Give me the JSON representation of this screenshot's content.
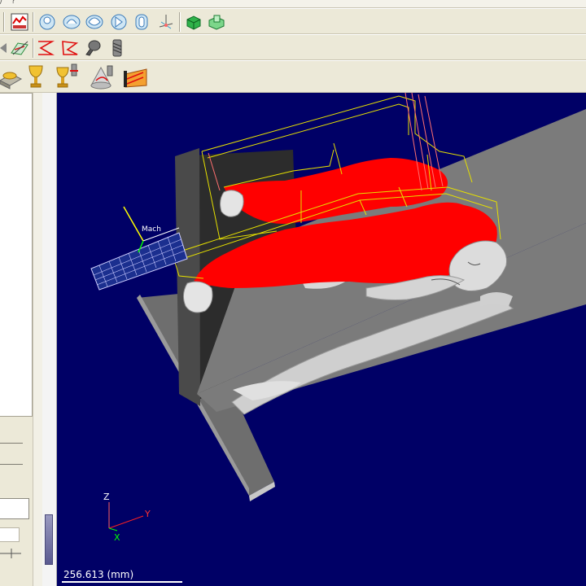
{
  "menubar": {
    "items": [
      "/",
      "?"
    ]
  },
  "toolbar1": {
    "icons": [
      "report-icon",
      "view-front-icon",
      "view-left-icon",
      "view-top-icon",
      "view-right-icon",
      "view-back-icon",
      "view-axis-icon",
      "stock-icon",
      "part-icon"
    ]
  },
  "toolbar2": {
    "icons": [
      "toolpath-edit-icon",
      "zigzag-icon",
      "polyline-icon",
      "tool-icon",
      "drill-icon"
    ]
  },
  "toolbar3": {
    "icons": [
      "surface-icon",
      "trophy-icon",
      "trophy-tool-icon",
      "cone-icon",
      "region-icon"
    ]
  },
  "viewport": {
    "background": "#000066",
    "scale_value": "256.613 (mm)",
    "axis": {
      "z": "Z",
      "y": "Y",
      "x": "X"
    },
    "grid_label": "Mach",
    "colors": {
      "stock": "#8a8a8a",
      "model": "#d6d6d6",
      "highlight": "#ff0000",
      "toolpath": "#e6e000"
    }
  }
}
